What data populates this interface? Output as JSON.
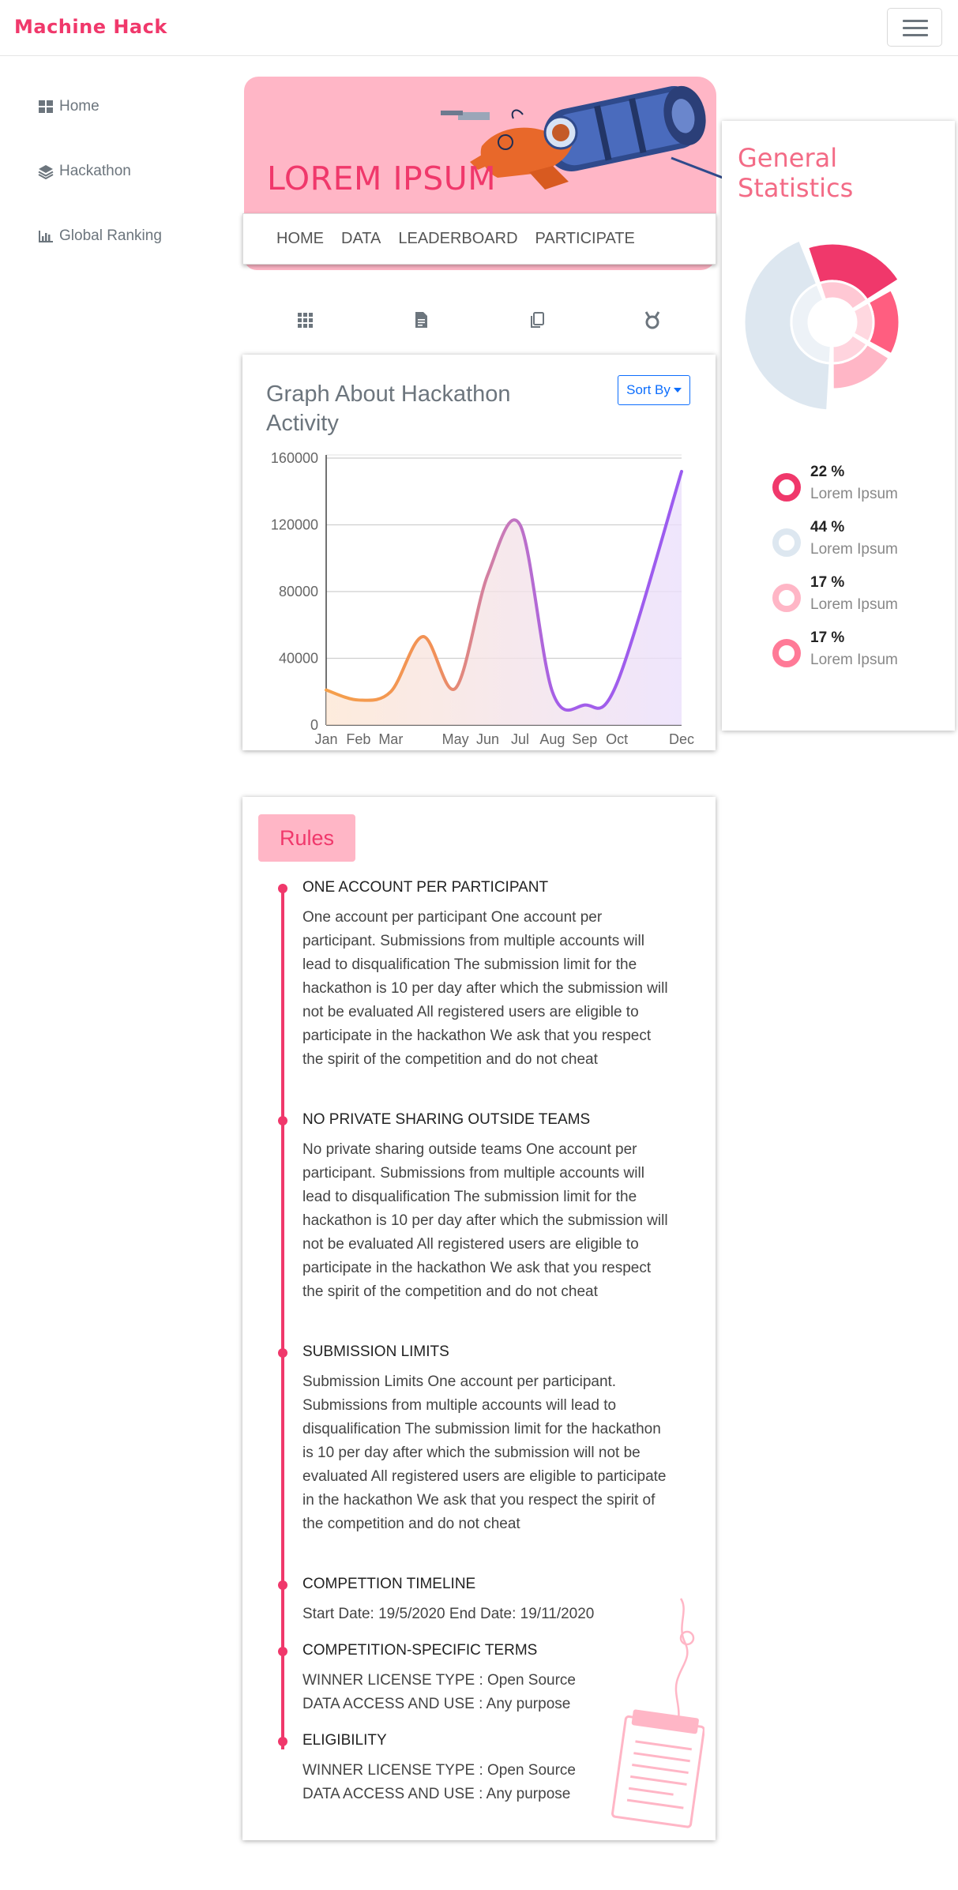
{
  "brand": {
    "logo_text": "Machine Hack"
  },
  "sidebar": {
    "items": [
      {
        "label": "Home",
        "icon": "grid-icon"
      },
      {
        "label": "Hackathon",
        "icon": "layers-icon"
      },
      {
        "label": "Global Ranking",
        "icon": "bar-chart-icon"
      }
    ]
  },
  "banner": {
    "title": "LOREM IPSUM",
    "nav": [
      "HOME",
      "DATA",
      "LEADERBOARD",
      "PARTICIPATE"
    ]
  },
  "icon_row": [
    "grid-icon",
    "document-icon",
    "copy-icon",
    "medal-icon"
  ],
  "activity_card": {
    "title": "Graph About Hackathon Activity",
    "sort_label": "Sort By"
  },
  "chart_data": {
    "type": "area",
    "x_tick_labels": [
      "Jan",
      "Feb",
      "Mar",
      "May",
      "Jun",
      "Jul",
      "Aug",
      "Sep",
      "Oct",
      "Dec"
    ],
    "y_tick_labels": [
      "0",
      "40000",
      "80000",
      "120000",
      "160000"
    ],
    "ylim": [
      0,
      160000
    ],
    "series": [
      {
        "points": [
          [
            "Jan",
            21000
          ],
          [
            "Feb",
            15000
          ],
          [
            "Mar",
            20000
          ],
          [
            "Apr",
            53000
          ],
          [
            "May",
            22000
          ],
          [
            "Jun",
            90000
          ],
          [
            "Jul",
            120000
          ],
          [
            "Aug",
            20000
          ],
          [
            "Sep",
            12000
          ],
          [
            "Oct",
            25000
          ],
          [
            "Dec",
            152000
          ]
        ]
      }
    ],
    "grid": true
  },
  "stats": {
    "title": "General Statistics",
    "legend": [
      {
        "pct": "22 %",
        "label": "Lorem Ipsum",
        "color": "#f0386b"
      },
      {
        "pct": "44 %",
        "label": "Lorem Ipsum",
        "color": "#dde7f0"
      },
      {
        "pct": "17 %",
        "label": "Lorem Ipsum",
        "color": "#ffb6c6"
      },
      {
        "pct": "17 %",
        "label": "Lorem Ipsum",
        "color": "#ff7a97"
      }
    ],
    "donut_values": [
      22,
      17,
      17,
      44
    ]
  },
  "rules": {
    "tag": "Rules",
    "items": [
      {
        "head": "ONE ACCOUNT PER PARTICIPANT",
        "body": "One account per participant One account per participant. Submissions from multiple accounts will lead to disqualification The submission limit for the hackathon is 10 per day after which the submission will not be evaluated All registered users are eligible to participate in the hackathon We ask that you respect the spirit of the competition and do not cheat"
      },
      {
        "head": "NO PRIVATE SHARING OUTSIDE TEAMS",
        "body": "No private sharing outside teams One account per participant. Submissions from multiple accounts will lead to disqualification The submission limit for the hackathon is 10 per day after which the submission will not be evaluated All registered users are eligible to participate in the hackathon We ask that you respect the spirit of the competition and do not cheat"
      },
      {
        "head": "SUBMISSION LIMITS",
        "body": "Submission Limits One account per participant. Submissions from multiple accounts will lead to disqualification The submission limit for the hackathon is 10 per day after which the submission will not be evaluated All registered users are eligible to participate in the hackathon We ask that you respect the spirit of the competition and do not cheat"
      },
      {
        "head": "COMPETTION TIMELINE",
        "body": "Start Date: 19/5/2020 End Date: 19/11/2020"
      },
      {
        "head": "COMPETITION-SPECIFIC TERMS",
        "body_lines": [
          "WINNER LICENSE TYPE : Open Source",
          "DATA ACCESS AND USE : Any purpose"
        ]
      },
      {
        "head": "ELIGIBILITY",
        "body_lines": [
          "WINNER LICENSE TYPE : Open Source",
          "DATA ACCESS AND USE : Any purpose"
        ]
      }
    ]
  }
}
